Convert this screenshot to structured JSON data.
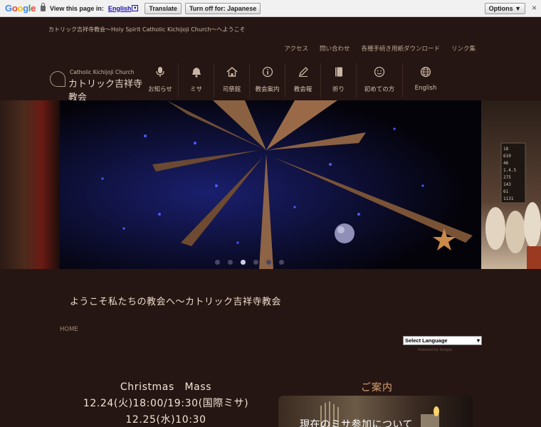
{
  "translate_bar": {
    "logo": "Google",
    "label": "View this page in:",
    "language": "English",
    "translate_button": "Translate",
    "turn_off_button": "Turn off for: Japanese",
    "options_button": "Options ▼",
    "close": "×"
  },
  "header": {
    "tagline": "カトリック吉祥寺教会～Holy Spirit Catholic Kichijoji Church～へようこそ",
    "top_links": [
      "アクセス",
      "問い合わせ",
      "各種手続き用紙ダウンロード",
      "リンク集"
    ],
    "logo_en": "Catholic Kichijoji Church",
    "logo_jp": "カトリック吉祥寺教会",
    "nav": [
      {
        "label": "お知らせ",
        "icon": "microphone-icon"
      },
      {
        "label": "ミサ",
        "icon": "bell-icon"
      },
      {
        "label": "司祭館",
        "icon": "home-icon"
      },
      {
        "label": "教会案内",
        "icon": "info-icon"
      },
      {
        "label": "教会報",
        "icon": "pencil-icon"
      },
      {
        "label": "祈り",
        "icon": "book-icon"
      },
      {
        "label": "初めての方",
        "icon": "smile-icon"
      },
      {
        "label": "English",
        "icon": "globe-icon"
      }
    ]
  },
  "hero": {
    "slide_count": 6,
    "active_slide": 3,
    "board_numbers": [
      "18",
      "610",
      "46",
      "1.4.5",
      "275",
      "143",
      "61",
      "1131"
    ]
  },
  "main": {
    "welcome": "ようこそ私たちの教会へ～カトリック吉祥寺教会",
    "breadcrumb": "HOME",
    "language_select": "Select Language",
    "powered_by": "Powered by Google",
    "christmas": {
      "title": "Christmas　Mass",
      "line1": "12.24(火)18:00/19:30(国際ミサ)",
      "line2": "12.25(水)10:30"
    },
    "guide_title": "ご案内",
    "guide_card": "現在のミサ参加について"
  },
  "colors": {
    "background": "#261613",
    "accent": "#d8a274"
  }
}
